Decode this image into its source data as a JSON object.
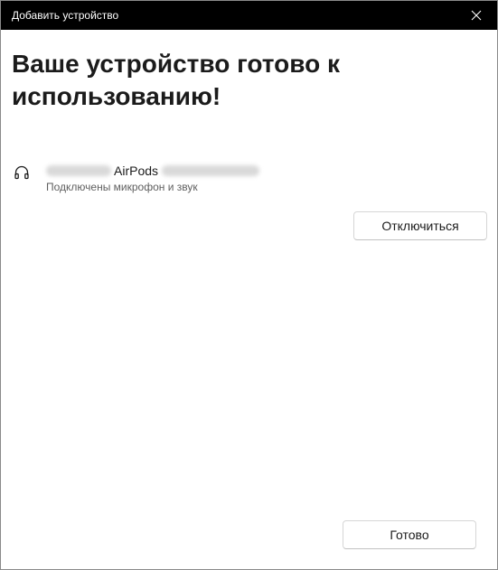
{
  "window": {
    "title": "Добавить устройство"
  },
  "icons": {
    "close": "close-icon",
    "device": "headphones-icon"
  },
  "main": {
    "heading": "Ваше устройство готово к использованию!"
  },
  "device": {
    "name": "AirPods",
    "status": "Подключены микрофон и звук"
  },
  "buttons": {
    "disconnect_label": "Отключиться",
    "done_label": "Готово"
  },
  "colors": {
    "titlebar_bg": "#000000",
    "window_bg": "#ffffff",
    "text_primary": "#1b1b1b",
    "text_secondary": "#5f5f5f"
  }
}
